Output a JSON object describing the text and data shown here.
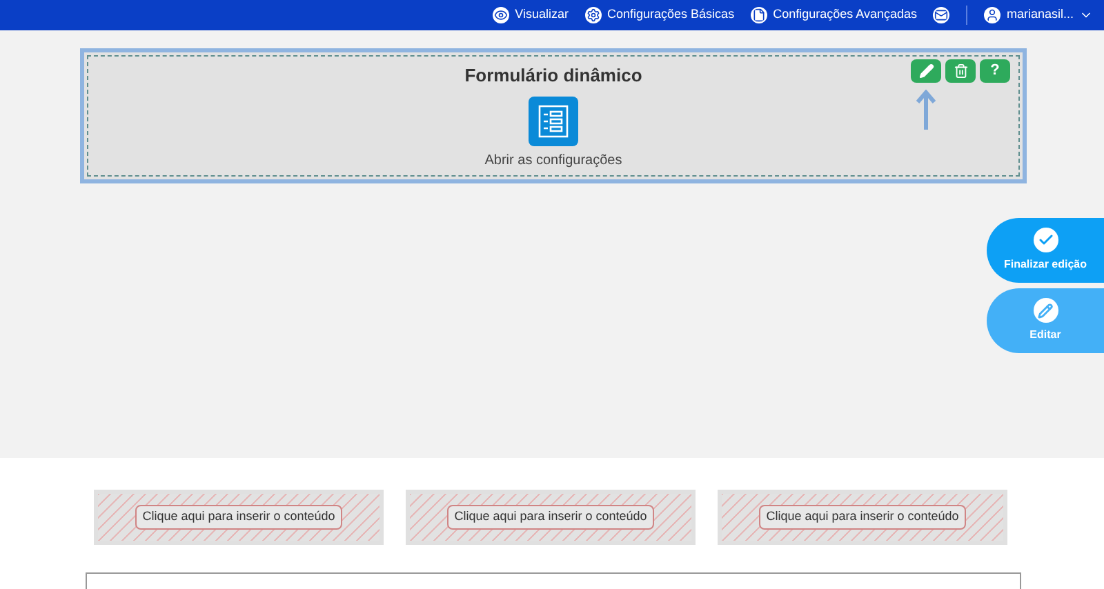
{
  "top_bar": {
    "items": [
      {
        "kind": "view",
        "label": "Visualizar"
      },
      {
        "kind": "basic",
        "label": "Configurações Básicas"
      },
      {
        "kind": "advanced",
        "label": "Configurações Avançadas"
      }
    ],
    "user": "marianasil..."
  },
  "widget": {
    "title": "Formulário dinâmico",
    "open_label": "Abrir as configurações",
    "tools": [
      {
        "kind": "edit"
      },
      {
        "kind": "delete"
      },
      {
        "kind": "help",
        "label": "?"
      }
    ]
  },
  "side_actions": [
    {
      "kind": "finish",
      "label": "Finalizar edição"
    },
    {
      "kind": "edit",
      "label": "Editar"
    }
  ],
  "slots": [
    {
      "label": "Clique aqui para inserir o conteúdo"
    },
    {
      "label": "Clique aqui para inserir o conteúdo"
    },
    {
      "label": "Clique aqui para inserir o conteúdo"
    }
  ]
}
